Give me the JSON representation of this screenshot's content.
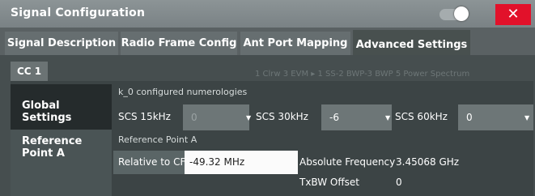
{
  "window": {
    "title": "Signal Configuration",
    "close_label": "✕"
  },
  "tabs": [
    {
      "label": "Signal Description",
      "active": false
    },
    {
      "label": "Radio Frame Config",
      "active": false
    },
    {
      "label": "Ant Port Mapping",
      "active": false
    },
    {
      "label": "Advanced Settings",
      "active": true
    }
  ],
  "carrier_tab": {
    "label": "CC 1"
  },
  "background_overlay": "1 Clrw   3 EVM   ▸ 1 SS-2 BWP-3 BWP   5 Power Spectrum",
  "sidebar": {
    "global_settings": "Global Settings",
    "reference_point_a": "Reference Point A"
  },
  "numerologies": {
    "section_label": "k_0 configured numerologies",
    "scs15_label": "SCS 15kHz",
    "scs15_value": "0",
    "scs30_label": "SCS 30kHz",
    "scs30_value": "-6",
    "scs60_label": "SCS 60kHz",
    "scs60_value": "0"
  },
  "reference_point": {
    "section_label": "Reference Point A",
    "relative_label": "Relative to CF",
    "relative_value": "-49.32 MHz",
    "abs_freq_label": "Absolute Frequency",
    "abs_freq_value": "3.45068 GHz",
    "txbw_label": "TxBW Offset",
    "txbw_value": "0"
  },
  "colors": {
    "close": "#e2112a",
    "accent_input": "#fbfbfb"
  }
}
